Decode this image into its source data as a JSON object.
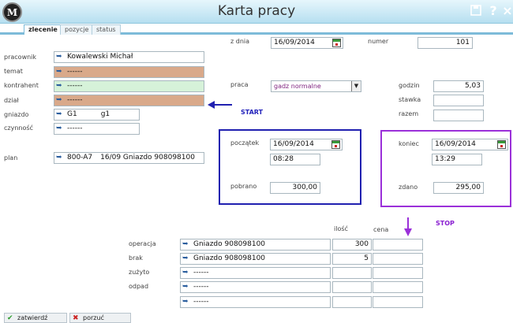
{
  "app": {
    "logo_text": "M",
    "title": "Karta pracy"
  },
  "tabs": [
    {
      "label": "zlecenie",
      "active": true
    },
    {
      "label": "pozycje",
      "active": false
    },
    {
      "label": "status",
      "active": false
    }
  ],
  "left": {
    "pracownik": {
      "label": "pracownik",
      "value": "Kowalewski Michał"
    },
    "temat": {
      "label": "temat",
      "value": "------"
    },
    "kontrahent": {
      "label": "kontrahent",
      "value": "------"
    },
    "dzial": {
      "label": "dział",
      "value": "------"
    },
    "gniazdo": {
      "label": "gniazdo",
      "value": "G1",
      "value2": "g1"
    },
    "czynnosc": {
      "label": "czynność",
      "value": "------"
    },
    "plan": {
      "label": "plan",
      "value": "800-A7",
      "value2": "16/09 Gniazdo 908098100"
    }
  },
  "annotations": {
    "start": "START",
    "stop": "STOP"
  },
  "header": {
    "z_dnia": {
      "label": "z dnia",
      "value": "16/09/2014"
    },
    "numer": {
      "label": "numer",
      "value": "101"
    },
    "praca": {
      "label": "praca",
      "value": "gadz normalne"
    },
    "godzin": {
      "label": "godzin",
      "value": "5,03"
    },
    "stawka": {
      "label": "stawka",
      "value": ""
    },
    "razem": {
      "label": "razem",
      "value": ""
    }
  },
  "start_box": {
    "poczatek": {
      "label": "początek",
      "date": "16/09/2014",
      "time": "08:28"
    },
    "pobrano": {
      "label": "pobrano",
      "value": "300,00"
    }
  },
  "stop_box": {
    "koniec": {
      "label": "koniec",
      "date": "16/09/2014",
      "time": "13:29"
    },
    "zdano": {
      "label": "zdano",
      "value": "295,00"
    }
  },
  "ops": {
    "col_ilosc": "ilość",
    "col_cena": "cena",
    "rows": [
      {
        "label": "operacja",
        "name": "Gniazdo 908098100",
        "ilosc": "300",
        "cena": ""
      },
      {
        "label": "brak",
        "name": "Gniazdo 908098100",
        "ilosc": "5",
        "cena": ""
      },
      {
        "label": "zużyto",
        "name": "------",
        "ilosc": "",
        "cena": ""
      },
      {
        "label": "odpad",
        "name": "------",
        "ilosc": "",
        "cena": ""
      },
      {
        "label": "",
        "name": "------",
        "ilosc": "",
        "cena": ""
      }
    ]
  },
  "buttons": {
    "approve": "zatwierdź",
    "cancel": "porzuć"
  },
  "colors": {
    "start_box": "#2020b0",
    "stop_box": "#9b30d9",
    "peach_field": "#d9a98a",
    "mint_field": "#d6f2d9"
  }
}
